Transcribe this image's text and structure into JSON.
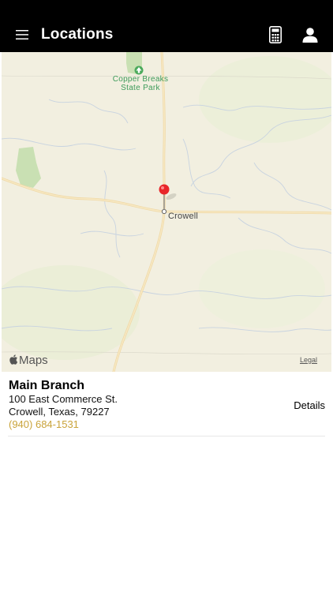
{
  "header": {
    "title": "Locations",
    "menu_icon": "hamburger-menu-icon",
    "calculator_icon": "calculator-icon",
    "account_icon": "person-icon",
    "background": "#000000",
    "text_color": "#ffffff"
  },
  "map": {
    "park_label": "Copper Breaks\nState Park",
    "city_label": "Crowell",
    "attribution": "Maps",
    "legal_label": "Legal",
    "park_color": "#3d9b5a",
    "pin_color": "#e8262a"
  },
  "branch": {
    "name": "Main Branch",
    "street": "100 East Commerce St.",
    "city_state_zip": "Crowell, Texas, 79227",
    "phone": "(940) 684-1531",
    "phone_color": "#c9a33a",
    "details_label": "Details"
  }
}
